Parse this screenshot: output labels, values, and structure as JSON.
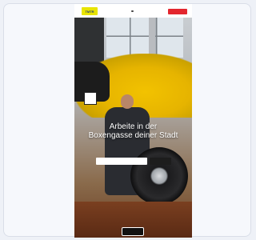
{
  "header": {
    "logo_text": "TMTR",
    "cta_label": ""
  },
  "hero": {
    "headline_line1": "Arbeite in der",
    "headline_line2": "Boxengasse deiner Stadt"
  },
  "search": {
    "placeholder": "",
    "button_label": ""
  },
  "footer": {
    "button_label": ""
  },
  "colors": {
    "logo_bg": "#e8e400",
    "cta_bg": "#e3262e",
    "button_bg": "#111111"
  }
}
